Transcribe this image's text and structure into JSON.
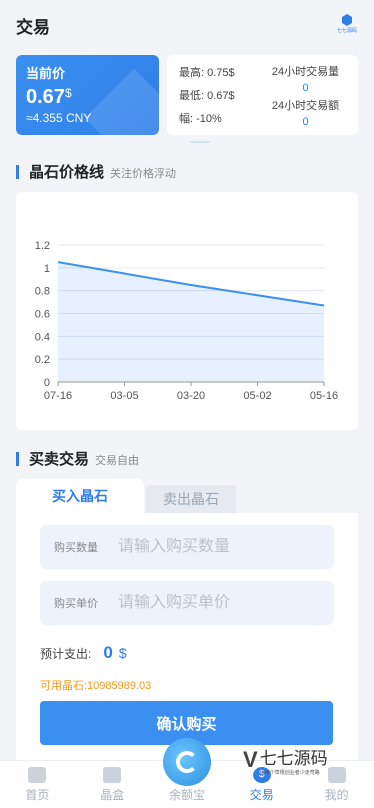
{
  "header": {
    "title": "交易",
    "logo_icon": "hexagon-logo-icon",
    "logo_label": "七七源码"
  },
  "price_card": {
    "label": "当前价",
    "price": "0.67",
    "unit": "$",
    "cny": "≈4.355 CNY"
  },
  "stats": {
    "high": "最高: 0.75$",
    "low": "最低: 0.67$",
    "change": "幅: -10%",
    "volume_label": "24小时交易量",
    "volume_value": "0",
    "turnover_label": "24小时交易额",
    "turnover_value": "0"
  },
  "chart_section": {
    "title": "晶石价格线",
    "subtitle": "关注价格浮动"
  },
  "chart_data": {
    "type": "area",
    "x": [
      "07-16",
      "03-05",
      "03-20",
      "05-02",
      "05-16"
    ],
    "values": [
      1.05,
      0.95,
      0.85,
      0.76,
      0.67
    ],
    "yticks": [
      "1.2",
      "1",
      "0.8",
      "0.6",
      "0.4",
      "0.2",
      "0"
    ],
    "ylim": [
      0,
      1.2
    ],
    "grid": true,
    "color": "#3a8ff0"
  },
  "trade_section": {
    "title": "买卖交易",
    "subtitle": "交易自由"
  },
  "trade": {
    "tab_buy": "买入晶石",
    "tab_sell": "卖出晶石",
    "qty_label": "购买数量",
    "qty_placeholder": "请输入购买数量",
    "price_label": "购买单价",
    "price_placeholder": "请输入购买单价",
    "expense_label": "预计支出:",
    "expense_value": "0",
    "expense_unit": "$",
    "available": "可用晶石:10985989.03",
    "confirm": "确认购买"
  },
  "tabbar": {
    "items": [
      {
        "label": "首页",
        "icon": "home-icon"
      },
      {
        "label": "晶盒",
        "icon": "box-icon"
      },
      {
        "label": "余额宝",
        "icon": "wallet-icon"
      },
      {
        "label": "交易",
        "icon": "dollar-icon"
      },
      {
        "label": "我的",
        "icon": "user-icon"
      }
    ],
    "active_symbol": "$"
  },
  "watermark": {
    "mark": "V",
    "title": "七七源码",
    "tagline": "让每个草根创业者少走弯路"
  },
  "colors": {
    "accent": "#2f7ee8",
    "warning": "#f39a1a",
    "background": "#f2f4f7"
  }
}
